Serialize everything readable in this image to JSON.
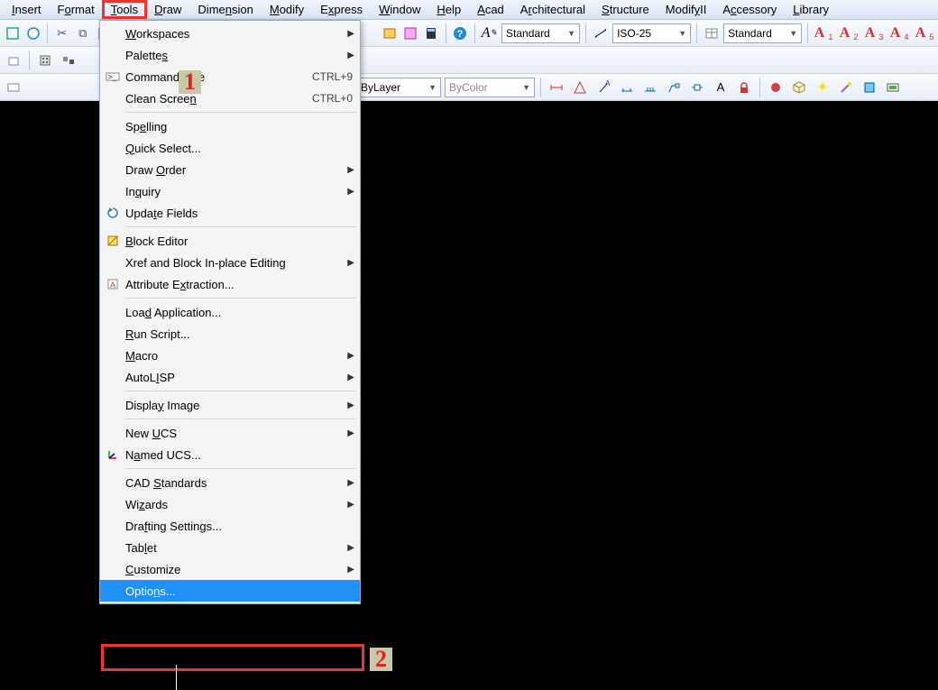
{
  "menubar": {
    "items": [
      {
        "pre": "",
        "u": "I",
        "post": "nsert"
      },
      {
        "pre": "F",
        "u": "o",
        "post": "rmat"
      },
      {
        "pre": "",
        "u": "T",
        "post": "ools",
        "highlight": true
      },
      {
        "pre": "",
        "u": "D",
        "post": "raw"
      },
      {
        "pre": "Dime",
        "u": "n",
        "post": "sion"
      },
      {
        "pre": "",
        "u": "M",
        "post": "odify"
      },
      {
        "pre": "E",
        "u": "x",
        "post": "press"
      },
      {
        "pre": "",
        "u": "W",
        "post": "indow"
      },
      {
        "pre": "",
        "u": "H",
        "post": "elp"
      },
      {
        "pre": "",
        "u": "A",
        "post": "cad"
      },
      {
        "pre": "A",
        "u": "r",
        "post": "chitectural"
      },
      {
        "pre": "",
        "u": "S",
        "post": "tructure"
      },
      {
        "pre": "Modif",
        "u": "y",
        "post": "II"
      },
      {
        "pre": "A",
        "u": "c",
        "post": "cessory"
      },
      {
        "pre": "",
        "u": "L",
        "post": "ibrary"
      }
    ]
  },
  "toolbar1": {
    "combo_text_style": "Standard",
    "combo_dim_style": "ISO-25",
    "combo_table_style": "Standard",
    "astyles": [
      "1",
      "2",
      "3",
      "4",
      "5"
    ]
  },
  "toolbar3": {
    "linetype": "ByLayer",
    "lineweight": "ByLayer",
    "plotstyle": "ByColor"
  },
  "dropdown": {
    "groups": [
      [
        {
          "pre": "",
          "u": "W",
          "post": "orkspaces",
          "sub": true
        },
        {
          "pre": "Palette",
          "u": "s",
          "post": "",
          "sub": true
        },
        {
          "pre": "Command ",
          "u": "L",
          "post": "ine",
          "shortcut": "CTRL+9",
          "icon": "cmdline"
        },
        {
          "pre": "Clean Scree",
          "u": "n",
          "post": "",
          "shortcut": "CTRL+0"
        }
      ],
      [
        {
          "pre": "Sp",
          "u": "e",
          "post": "lling"
        },
        {
          "pre": "",
          "u": "Q",
          "post": "uick Select..."
        },
        {
          "pre": "Draw ",
          "u": "O",
          "post": "rder",
          "sub": true
        },
        {
          "pre": "In",
          "u": "q",
          "post": "uiry",
          "sub": true
        },
        {
          "pre": "Upda",
          "u": "t",
          "post": "e Fields",
          "icon": "update"
        }
      ],
      [
        {
          "pre": "",
          "u": "B",
          "post": "lock Editor",
          "icon": "block"
        },
        {
          "pre": "Xref and Block In-place Editin",
          "u": "g",
          "post": "",
          "sub": true
        },
        {
          "pre": "Attribute E",
          "u": "x",
          "post": "traction...",
          "icon": "attr"
        }
      ],
      [
        {
          "pre": "Loa",
          "u": "d",
          "post": " Application..."
        },
        {
          "pre": "",
          "u": "R",
          "post": "un Script..."
        },
        {
          "pre": "",
          "u": "M",
          "post": "acro",
          "sub": true
        },
        {
          "pre": "AutoL",
          "u": "I",
          "post": "SP",
          "sub": true
        }
      ],
      [
        {
          "pre": "Displa",
          "u": "y",
          "post": " Image",
          "sub": true
        }
      ],
      [
        {
          "pre": "New ",
          "u": "U",
          "post": "CS",
          "sub": true
        },
        {
          "pre": "N",
          "u": "a",
          "post": "med UCS...",
          "icon": "ucs"
        }
      ],
      [
        {
          "pre": "CAD ",
          "u": "S",
          "post": "tandards",
          "sub": true
        },
        {
          "pre": "Wi",
          "u": "z",
          "post": "ards",
          "sub": true
        },
        {
          "pre": "Dra",
          "u": "f",
          "post": "ting Settings..."
        },
        {
          "pre": "Tab",
          "u": "l",
          "post": "et",
          "sub": true
        },
        {
          "pre": "",
          "u": "C",
          "post": "ustomize",
          "sub": true
        },
        {
          "pre": "Optio",
          "u": "n",
          "post": "s...",
          "selected": true
        }
      ]
    ]
  },
  "callouts": {
    "one": "1",
    "two": "2"
  }
}
